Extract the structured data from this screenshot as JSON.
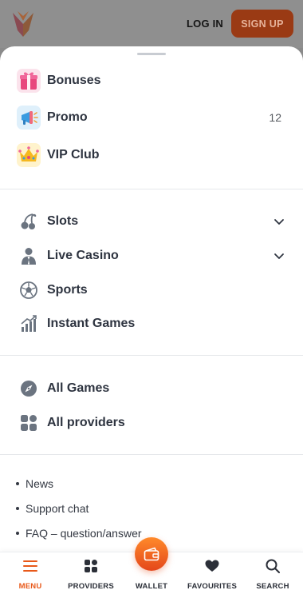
{
  "header": {
    "login_label": "LOG IN",
    "signup_label": "SIGN UP"
  },
  "menu": {
    "top": [
      {
        "label": "Bonuses",
        "icon": "gift-icon"
      },
      {
        "label": "Promo",
        "icon": "megaphone-icon",
        "count": "12"
      },
      {
        "label": "VIP Club",
        "icon": "crown-icon"
      }
    ],
    "games": [
      {
        "label": "Slots",
        "icon": "cherries-icon",
        "expandable": true
      },
      {
        "label": "Live Casino",
        "icon": "dealer-icon",
        "expandable": true
      },
      {
        "label": "Sports",
        "icon": "soccer-ball-icon"
      },
      {
        "label": "Instant Games",
        "icon": "bar-chart-icon"
      }
    ],
    "browse": [
      {
        "label": "All Games",
        "icon": "compass-icon"
      },
      {
        "label": "All providers",
        "icon": "grid-icon"
      }
    ],
    "links": [
      {
        "label": "News"
      },
      {
        "label": "Support chat"
      },
      {
        "label": "FAQ – question/answer"
      }
    ]
  },
  "bottom_nav": [
    {
      "label": "MENU",
      "icon": "hamburger-icon",
      "active": true
    },
    {
      "label": "PROVIDERS",
      "icon": "grid-icon"
    },
    {
      "label": "WALLET",
      "icon": "wallet-icon"
    },
    {
      "label": "FAVOURITES",
      "icon": "heart-icon"
    },
    {
      "label": "SEARCH",
      "icon": "search-icon"
    }
  ],
  "colors": {
    "accent": "#e8591a",
    "signup_bg": "#9a3a14",
    "text": "#2e3440",
    "icon_gray": "#6b7480"
  }
}
